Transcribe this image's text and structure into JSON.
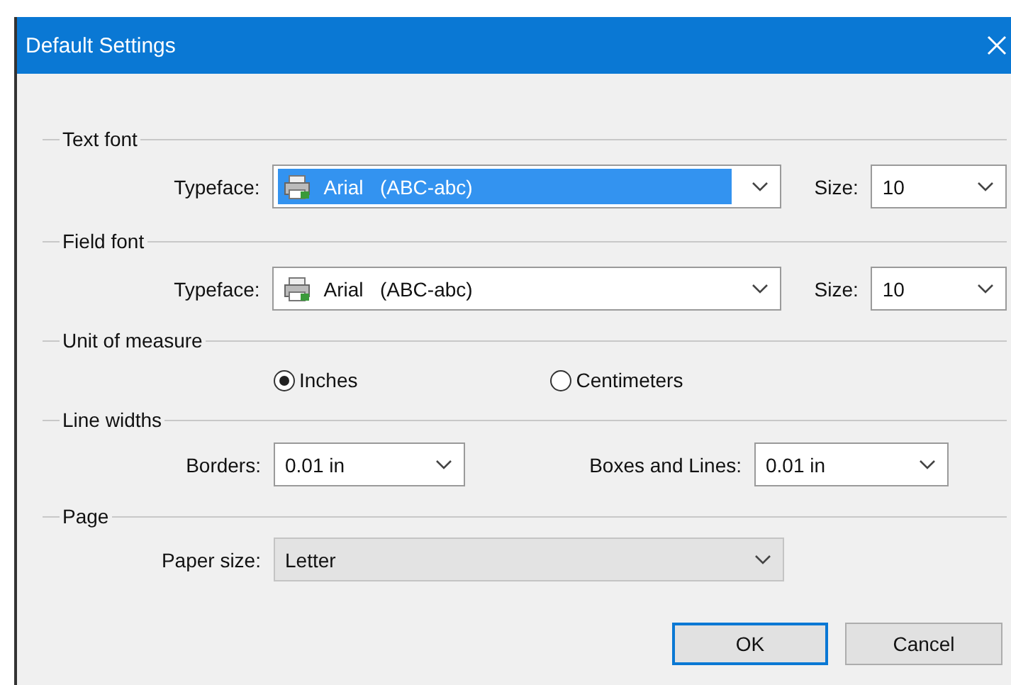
{
  "window": {
    "title": "Default Settings"
  },
  "text_font": {
    "legend": "Text font",
    "typeface_label": "Typeface:",
    "typeface": "Arial   (ABC-abc)",
    "typeface_selected": true,
    "size_label": "Size:",
    "size": "10"
  },
  "field_font": {
    "legend": "Field font",
    "typeface_label": "Typeface:",
    "typeface": "Arial   (ABC-abc)",
    "typeface_selected": false,
    "size_label": "Size:",
    "size": "10"
  },
  "unit": {
    "legend": "Unit of measure",
    "options": [
      {
        "label": "Inches",
        "selected": true
      },
      {
        "label": "Centimeters",
        "selected": false
      }
    ]
  },
  "line_widths": {
    "legend": "Line widths",
    "borders_label": "Borders:",
    "borders": "0.01 in",
    "boxes_label": "Boxes and Lines:",
    "boxes": "0.01 in"
  },
  "page": {
    "legend": "Page",
    "paper_label": "Paper size:",
    "paper": "Letter",
    "disabled": true
  },
  "buttons": [
    {
      "label": "OK",
      "default": true
    },
    {
      "label": "Cancel",
      "default": false
    }
  ]
}
